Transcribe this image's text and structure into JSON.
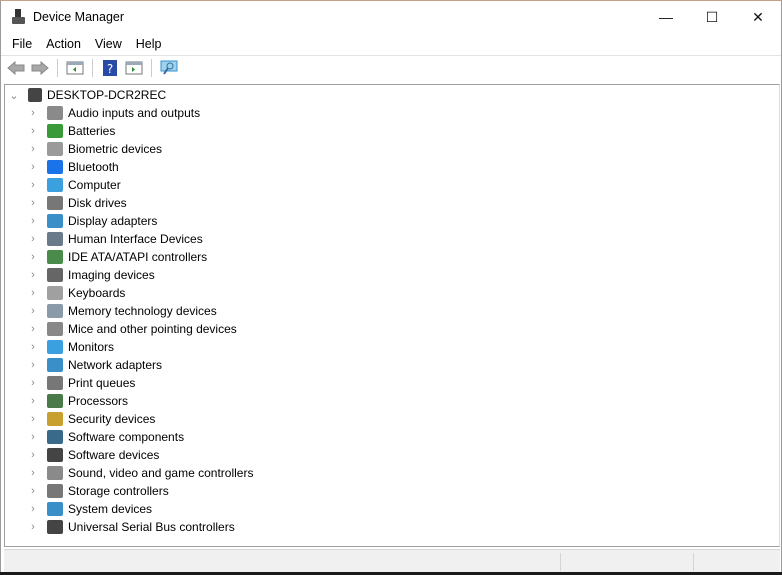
{
  "window": {
    "title": "Device Manager",
    "minimize": "—",
    "maximize": "☐",
    "close": "✕"
  },
  "menu": [
    "File",
    "Action",
    "View",
    "Help"
  ],
  "toolbar": [
    "back-icon",
    "forward-icon",
    "show-hide-console-tree-icon",
    "help-icon",
    "action-pane-icon",
    "scan-hardware-changes-icon"
  ],
  "tree": {
    "root": "DESKTOP-DCR2REC",
    "items": [
      {
        "label": "Audio inputs and outputs",
        "icon": "speaker-icon",
        "color": "#8a8a8a"
      },
      {
        "label": "Batteries",
        "icon": "battery-icon",
        "color": "#3a9a3a"
      },
      {
        "label": "Biometric devices",
        "icon": "fingerprint-icon",
        "color": "#9a9a9a"
      },
      {
        "label": "Bluetooth",
        "icon": "bluetooth-icon",
        "color": "#1a73e8"
      },
      {
        "label": "Computer",
        "icon": "monitor-icon",
        "color": "#3aa0e0"
      },
      {
        "label": "Disk drives",
        "icon": "disk-drive-icon",
        "color": "#777777"
      },
      {
        "label": "Display adapters",
        "icon": "display-adapter-icon",
        "color": "#3a8fc8"
      },
      {
        "label": "Human Interface Devices",
        "icon": "hid-icon",
        "color": "#6a7a8a"
      },
      {
        "label": "IDE ATA/ATAPI controllers",
        "icon": "ide-controller-icon",
        "color": "#4a8a4a"
      },
      {
        "label": "Imaging devices",
        "icon": "camera-icon",
        "color": "#666666"
      },
      {
        "label": "Keyboards",
        "icon": "keyboard-icon",
        "color": "#a0a0a0"
      },
      {
        "label": "Memory technology devices",
        "icon": "memory-icon",
        "color": "#8a9aa8"
      },
      {
        "label": "Mice and other pointing devices",
        "icon": "mouse-icon",
        "color": "#888888"
      },
      {
        "label": "Monitors",
        "icon": "monitor-icon",
        "color": "#3aa0e0"
      },
      {
        "label": "Network adapters",
        "icon": "network-icon",
        "color": "#3a8fc8"
      },
      {
        "label": "Print queues",
        "icon": "printer-icon",
        "color": "#777777"
      },
      {
        "label": "Processors",
        "icon": "processor-icon",
        "color": "#4a7a4a"
      },
      {
        "label": "Security devices",
        "icon": "security-key-icon",
        "color": "#c8a030"
      },
      {
        "label": "Software components",
        "icon": "software-component-icon",
        "color": "#3a6a8a"
      },
      {
        "label": "Software devices",
        "icon": "software-device-icon",
        "color": "#444444"
      },
      {
        "label": "Sound, video and game controllers",
        "icon": "speaker-icon",
        "color": "#8a8a8a"
      },
      {
        "label": "Storage controllers",
        "icon": "storage-controller-icon",
        "color": "#777777"
      },
      {
        "label": "System devices",
        "icon": "system-devices-icon",
        "color": "#3a8fc8"
      },
      {
        "label": "Universal Serial Bus controllers",
        "icon": "usb-icon",
        "color": "#444444"
      }
    ]
  }
}
